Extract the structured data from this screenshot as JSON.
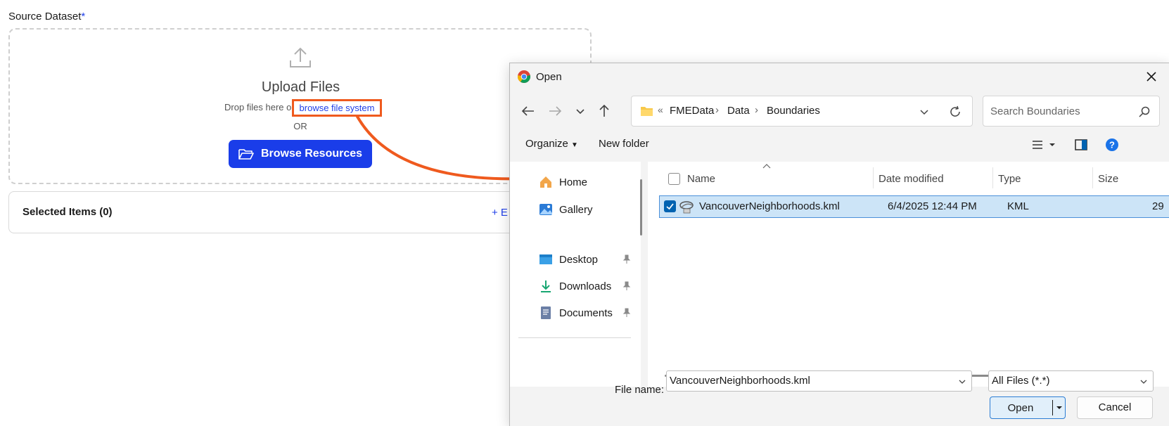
{
  "page": {
    "source_label": "Source Dataset",
    "required_mark": "*",
    "upload_title": "Upload Files",
    "drop_text": "Drop files here o",
    "browse_link": "browse file system",
    "or_text": "OR",
    "browse_resources": "Browse Resources",
    "selected_items": "Selected Items (0)",
    "add_link": "+ E"
  },
  "dialog": {
    "title": "Open",
    "breadcrumb_prefix": "«",
    "breadcrumbs": [
      "FMEData",
      "Data",
      "Boundaries"
    ],
    "search_placeholder": "Search Boundaries",
    "toolbar": {
      "organize": "Organize",
      "new_folder": "New folder"
    },
    "nav": {
      "home": "Home",
      "gallery": "Gallery",
      "desktop": "Desktop",
      "downloads": "Downloads",
      "documents": "Documents"
    },
    "columns": {
      "name": "Name",
      "date": "Date modified",
      "type": "Type",
      "size": "Size"
    },
    "files": [
      {
        "name": "VancouverNeighborhoods.kml",
        "date": "6/4/2025 12:44 PM",
        "type": "KML",
        "size": "29"
      }
    ],
    "file_name_label": "File name:",
    "file_name_value": "VancouverNeighborhoods.kml",
    "file_type": "All Files (*.*)",
    "open_button": "Open",
    "cancel_button": "Cancel"
  },
  "colors": {
    "accent_blue": "#1a3de9",
    "highlight_orange": "#ef5a1e",
    "selection": "#cce4f7"
  }
}
